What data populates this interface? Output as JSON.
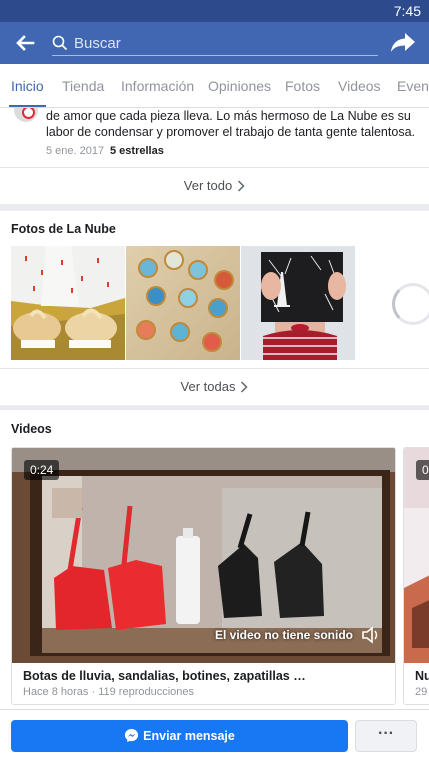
{
  "status_bar": {
    "time": "7:45"
  },
  "header": {
    "search_placeholder": "Buscar",
    "icons": {
      "back": "arrow-left-icon",
      "search": "search-icon",
      "share": "share-arrow-icon"
    }
  },
  "tabs": [
    {
      "label": "Inicio",
      "active": true
    },
    {
      "label": "Tienda",
      "active": false
    },
    {
      "label": "Información",
      "active": false
    },
    {
      "label": "Opiniones",
      "active": false
    },
    {
      "label": "Fotos",
      "active": false
    },
    {
      "label": "Videos",
      "active": false
    },
    {
      "label": "Event",
      "active": false
    }
  ],
  "review": {
    "text": "de amor que cada pieza lleva. Lo más hermoso de La Nube es su labor de condensar y promover el trabajo de tanta gente talentosa.",
    "date": "5 ene. 2017",
    "rating": "5 estrellas",
    "see_all_label": "Ver todo"
  },
  "photos": {
    "title": "Fotos de La Nube",
    "see_all_label": "Ver todas",
    "items": [
      "sneakers-photo",
      "pendants-photo",
      "eiffel-book-photo"
    ]
  },
  "videos": {
    "title": "Videos",
    "items": [
      {
        "duration": "0:24",
        "sound_notice": "El video no tiene sonido",
        "title": "Botas de lluvia, sandalias, botines, zapatillas …",
        "meta": "Hace 8 horas · 119 reproducciones"
      },
      {
        "duration": "0",
        "title": "Nu",
        "meta": "29"
      }
    ]
  },
  "bottom_bar": {
    "send_label": "Enviar mensaje",
    "more_label": "···"
  },
  "colors": {
    "brand": "#4267b2",
    "status_bar": "#2d4a8c",
    "send_button": "#1877f2"
  }
}
